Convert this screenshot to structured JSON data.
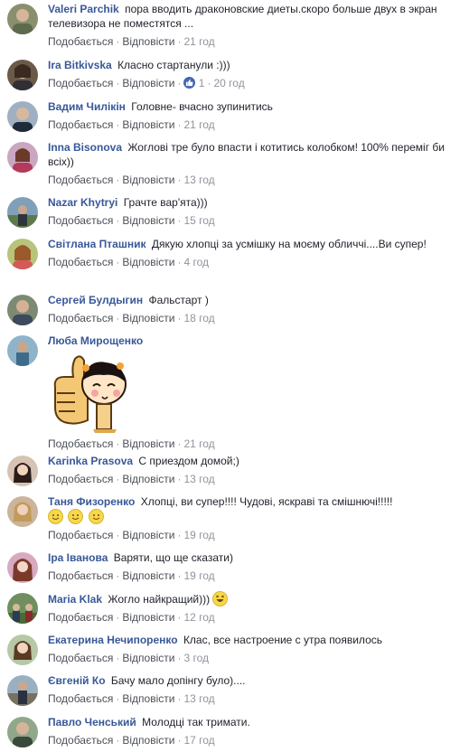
{
  "actions": {
    "like": "Подобається",
    "reply": "Відповісти"
  },
  "comments": [
    {
      "name": "Valeri Parchik",
      "text": "пора вводить драконовские диеты.скоро больше двух в экран телевизора не поместятся ...",
      "time": "21 год"
    },
    {
      "name": "Ira Bitkivska",
      "text": "Класно стартанули :)))",
      "time": "20 год",
      "reactions": "1"
    },
    {
      "name": "Вадим Чилікін",
      "text": "Головне- вчасно зупинитись",
      "time": "21 год"
    },
    {
      "name": "Inna Bisonova",
      "text": "Жоглові тре було впасти і котитись колобком! 100% переміг би всіх))",
      "time": "13 год"
    },
    {
      "name": "Nazar Khytryi",
      "text": "Грачте вар'ята)))",
      "time": "15 год"
    },
    {
      "name": "Світлана Пташник",
      "text": "Дякую хлопці за усмішку на моєму обличчі....Ви супер!",
      "time": "4 год"
    },
    {
      "name": "Сергей Булдыгин",
      "text": "Фальстарт )",
      "time": "18 год"
    },
    {
      "name": "Люба Мирощенко",
      "text": "",
      "time": "21 год"
    },
    {
      "name": "Karinka Prasova",
      "text": "С приездом домой;)",
      "time": "13 год"
    },
    {
      "name": "Таня Физоренко",
      "text": "Хлопці, ви супер!!!! Чудові, яскраві та смішнючі!!!!!",
      "time": "19 год"
    },
    {
      "name": "Іра Іванова",
      "text": "Варяти, що ще сказати)",
      "time": "19 год"
    },
    {
      "name": "Maria Klak",
      "text": "Жогло найкращий)))",
      "time": "12 год"
    },
    {
      "name": "Екатерина Нечипоренко",
      "text": "Клас, все настроение с утра появилось",
      "time": "3 год"
    },
    {
      "name": "Євгеній Ко",
      "text": "Бачу мало допінгу було)....",
      "time": "13 год"
    },
    {
      "name": "Павло Ченський",
      "text": "Молодці так тримати.",
      "time": "17 год"
    }
  ]
}
